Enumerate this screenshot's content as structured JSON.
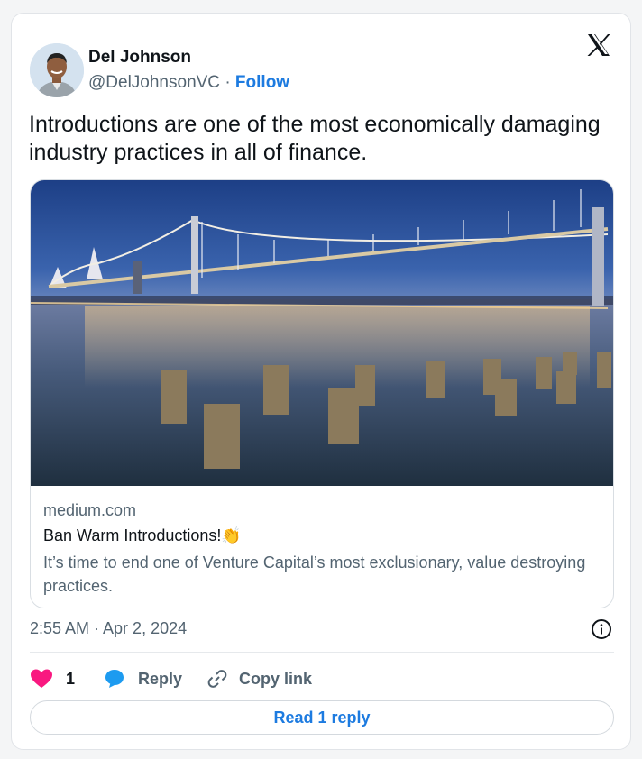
{
  "author": {
    "name": "Del Johnson",
    "handle": "@DelJohnsonVC",
    "separator": "·",
    "follow_label": "Follow"
  },
  "platform_icon": "x-logo-icon",
  "tweet": {
    "text_line1": "Introductions are one of the most economically damaging",
    "text_line2": "industry practices in all of finance."
  },
  "link_card": {
    "image_icon": "bay-bridge-photo",
    "domain": "medium.com",
    "title": "Ban Warm Introductions!",
    "title_emoji": "👏",
    "description": "It’s time to end one of Venture Capital’s most exclusionary, value destroying practices."
  },
  "meta": {
    "timestamp": "2:55 AM · Apr 2, 2024",
    "info_icon": "info-icon"
  },
  "actions": {
    "like_count": "1",
    "reply_label": "Reply",
    "copy_link_label": "Copy link"
  },
  "read_replies_label": "Read 1 reply",
  "colors": {
    "accent": "#1d7be0",
    "like": "#f91880",
    "reply_bubble": "#1d9bf0"
  }
}
